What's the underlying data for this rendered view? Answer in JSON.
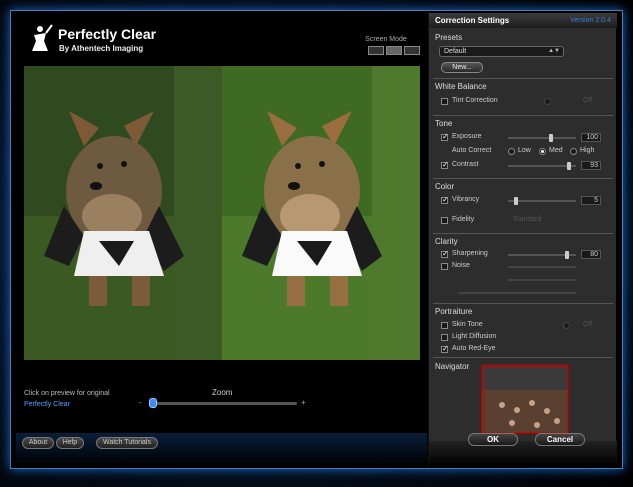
{
  "brand": {
    "title": "Perfectly Clear",
    "subtitle": "By Athentech Imaging"
  },
  "screen_mode": {
    "label": "Screen Mode"
  },
  "preview": {
    "hint": "Click on preview for original",
    "link": "Perfectly Clear"
  },
  "zoom": {
    "label": "Zoom",
    "minus": "-",
    "plus": "+",
    "level": 0.0
  },
  "footer_left": {
    "about": "About",
    "help": "Help",
    "tutorials": "Watch Tutorials"
  },
  "panel": {
    "title": "Correction Settings",
    "version": "Version 2.0.4"
  },
  "presets": {
    "label": "Presets",
    "selected": "Default",
    "new_button": "New..."
  },
  "white_balance": {
    "label": "White Balance",
    "tint": "Tint Correction",
    "tint_value": "Off"
  },
  "tone": {
    "label": "Tone",
    "exposure": "Exposure",
    "exposure_value": "100",
    "auto_correct": "Auto Correct",
    "low": "Low",
    "med": "Med",
    "high": "High",
    "contrast": "Contrast",
    "contrast_value": "93"
  },
  "color": {
    "label": "Color",
    "vibrancy": "Vibrancy",
    "vibrancy_value": "5",
    "fidelity": "Fidelity",
    "fidelity_value": "Standard"
  },
  "clarity": {
    "label": "Clarity",
    "sharpening": "Sharpening",
    "sharpening_value": "80",
    "noise": "Noise"
  },
  "portraiture": {
    "label": "Portraiture",
    "skin_tone": "Skin Tone",
    "skin_tone_value": "Off",
    "light_diffusion": "Light Diffusion",
    "red_eye": "Auto Red-Eye"
  },
  "navigator": {
    "label": "Navigator"
  },
  "footer_right": {
    "ok": "OK",
    "cancel": "Cancel"
  },
  "colors": {
    "accent": "#3b7bd8",
    "link": "#4fa3ff",
    "glow": "#1b6bd1"
  }
}
